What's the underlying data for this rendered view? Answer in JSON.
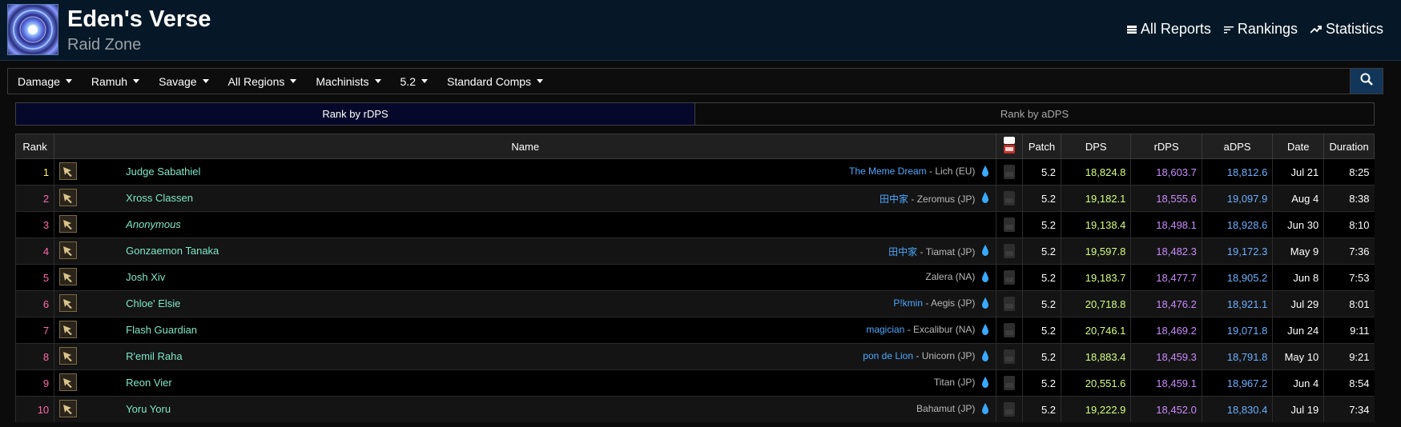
{
  "header": {
    "title": "Eden's Verse",
    "subtitle": "Raid Zone",
    "nav": [
      {
        "label": "All Reports",
        "icon": "list-icon"
      },
      {
        "label": "Rankings",
        "icon": "sort-icon"
      },
      {
        "label": "Statistics",
        "icon": "trend-icon"
      }
    ]
  },
  "filters": [
    "Damage",
    "Ramuh",
    "Savage",
    "All Regions",
    "Machinists",
    "5.2",
    "Standard Comps"
  ],
  "tabs": {
    "active": "Rank by rDPS",
    "inactive": "Rank by aDPS"
  },
  "table": {
    "headers": {
      "rank": "Rank",
      "name": "Name",
      "video": "You Tube",
      "patch": "Patch",
      "dps": "DPS",
      "rdps": "rDPS",
      "adps": "aDPS",
      "date": "Date",
      "duration": "Duration"
    },
    "rows": [
      {
        "rank": "1",
        "rank_color": "#ffef6b",
        "name": "Judge Sabathiel",
        "anon": false,
        "guild": "The Meme Dream",
        "server": " - Lich (EU)",
        "patch": "5.2",
        "dps": "18,824.8",
        "rdps": "18,603.7",
        "adps": "18,812.6",
        "date": "Jul 21",
        "duration": "8:25"
      },
      {
        "rank": "2",
        "rank_color": "#ff6aa8",
        "name": "Xross Classen",
        "anon": false,
        "guild": "田中家",
        "server": " - Zeromus (JP)",
        "patch": "5.2",
        "dps": "19,182.1",
        "rdps": "18,555.6",
        "adps": "19,097.9",
        "date": "Aug 4",
        "duration": "8:38"
      },
      {
        "rank": "3",
        "rank_color": "#ff6aa8",
        "name": "Anonymous",
        "anon": true,
        "guild": "",
        "server": "",
        "patch": "5.2",
        "dps": "19,138.4",
        "rdps": "18,498.1",
        "adps": "18,928.6",
        "date": "Jun 30",
        "duration": "8:10"
      },
      {
        "rank": "4",
        "rank_color": "#ff6aa8",
        "name": "Gonzaemon Tanaka",
        "anon": false,
        "guild": "田中家",
        "server": " - Tiamat (JP)",
        "patch": "5.2",
        "dps": "19,597.8",
        "rdps": "18,482.3",
        "adps": "19,172.3",
        "date": "May 9",
        "duration": "7:36"
      },
      {
        "rank": "5",
        "rank_color": "#ff6aa8",
        "name": "Josh Xiv",
        "anon": false,
        "guild": "",
        "server": "Zalera (NA)",
        "patch": "5.2",
        "dps": "19,183.7",
        "rdps": "18,477.7",
        "adps": "18,905.2",
        "date": "Jun 8",
        "duration": "7:53"
      },
      {
        "rank": "6",
        "rank_color": "#ff6aa8",
        "name": "Chloe' Elsie",
        "anon": false,
        "guild": "P!kmin",
        "server": " - Aegis (JP)",
        "patch": "5.2",
        "dps": "20,718.8",
        "rdps": "18,476.2",
        "adps": "18,921.1",
        "date": "Jul 29",
        "duration": "8:01"
      },
      {
        "rank": "7",
        "rank_color": "#ff6aa8",
        "name": "Flash Guardian",
        "anon": false,
        "guild": "magician",
        "server": " - Excalibur (NA)",
        "patch": "5.2",
        "dps": "20,746.1",
        "rdps": "18,469.2",
        "adps": "19,071.8",
        "date": "Jun 24",
        "duration": "9:11"
      },
      {
        "rank": "8",
        "rank_color": "#ff6aa8",
        "name": "R'emil Raha",
        "anon": false,
        "guild": "pon de Lion",
        "server": " - Unicorn (JP)",
        "patch": "5.2",
        "dps": "18,883.4",
        "rdps": "18,459.3",
        "adps": "18,791.8",
        "date": "May 10",
        "duration": "9:21"
      },
      {
        "rank": "9",
        "rank_color": "#ff6aa8",
        "name": "Reon Vier",
        "anon": false,
        "guild": "",
        "server": "Titan (JP)",
        "patch": "5.2",
        "dps": "20,551.6",
        "rdps": "18,459.1",
        "adps": "18,967.2",
        "date": "Jun 4",
        "duration": "8:54"
      },
      {
        "rank": "10",
        "rank_color": "#ff6aa8",
        "name": "Yoru Yoru",
        "anon": false,
        "guild": "",
        "server": "Bahamut (JP)",
        "patch": "5.2",
        "dps": "19,222.9",
        "rdps": "18,452.0",
        "adps": "18,830.4",
        "date": "Jul 19",
        "duration": "7:34"
      }
    ]
  },
  "colors": {
    "dps": "#d6ff7a",
    "rdps": "#c98bff",
    "adps": "#6ab0ff",
    "name": "#7ee8c8",
    "guild": "#4aa8ff",
    "header_bg": "#061827"
  }
}
